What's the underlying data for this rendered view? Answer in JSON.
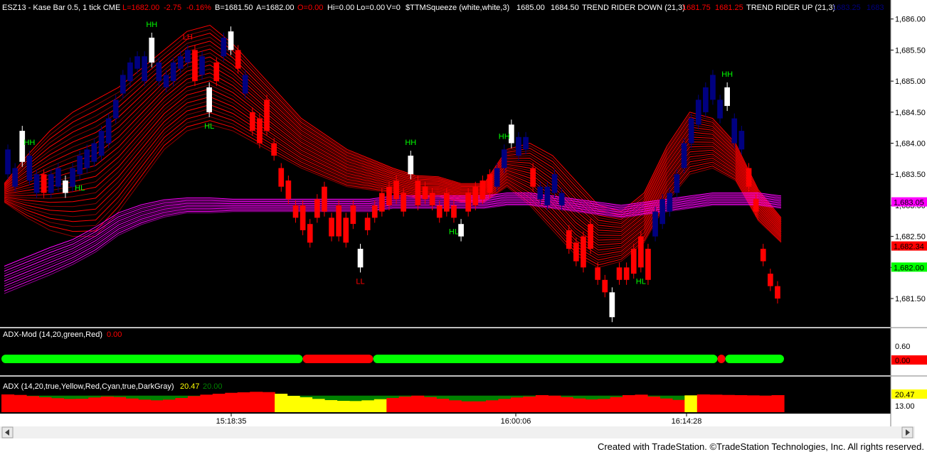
{
  "header": {
    "symbol": "ESZ13 - Kase Bar 0.5, 1 tick  CME",
    "last": "L=1682.00",
    "change": "-2.75",
    "pct": "-0.16%",
    "bid": "B=1681.50",
    "ask": "A=1682.00",
    "open": "O=0.00",
    "hi": "Hi=0.00",
    "lo": "Lo=0.00",
    "vol": "V=0",
    "squeeze": "$TTMSqueeze (white,white,3)",
    "sq1": "1685.00",
    "sq2": "1684.50",
    "trdown": "TREND RIDER DOWN (21,3)",
    "trd1": "1681.75",
    "trd2": "1681.25",
    "trup": "TREND RIDER UP (21,3)",
    "tru1": "1683.25",
    "tru2": "1683"
  },
  "colors": {
    "background": "#000000",
    "up_bar": "#000080",
    "down_bar": "#ff0000",
    "squeeze_bar": "#ffffff",
    "trend_down": "#ff0000",
    "trend_up": "#ff00ff",
    "adx_green": "#00ff00",
    "adx_red": "#ff0000",
    "adx_yellow": "#ffff00",
    "adx_fill_green": "#008000"
  },
  "chart_data": [
    {
      "type": "candlestick",
      "title": "ESZ13 - Kase Bar 0.5, 1 tick CME",
      "ylim": [
        1681.1,
        1686.1
      ],
      "y_ticks": [
        "1,686.00",
        "1,685.50",
        "1,685.00",
        "1,684.50",
        "1,684.00",
        "1,683.50",
        "1,683.00",
        "1,682.50",
        "1,682.00",
        "1,681.50"
      ],
      "x_ticks": [
        "15:18:35",
        "16:00:06",
        "16:14:28"
      ],
      "price_flags": [
        {
          "label": "1,683.05",
          "color": "#ff00ff"
        },
        {
          "label": "1,682.34",
          "color": "#ff0000"
        },
        {
          "label": "1,682.00",
          "color": "#00ff00"
        }
      ],
      "bars": [
        {
          "dir": "up",
          "o": 1683.5,
          "c": 1683.9
        },
        {
          "dir": "up",
          "o": 1683.3,
          "c": 1683.6
        },
        {
          "dir": "sq",
          "o": 1683.7,
          "c": 1684.2
        },
        {
          "dir": "up",
          "o": 1683.4,
          "c": 1683.8
        },
        {
          "dir": "up",
          "o": 1683.2,
          "c": 1683.5
        },
        {
          "dir": "down",
          "o": 1683.5,
          "c": 1683.2
        },
        {
          "dir": "up",
          "o": 1683.2,
          "c": 1683.5
        },
        {
          "dir": "up",
          "o": 1683.3,
          "c": 1683.6
        },
        {
          "dir": "sq",
          "o": 1683.2,
          "c": 1683.4
        },
        {
          "dir": "up",
          "o": 1683.3,
          "c": 1683.6
        },
        {
          "dir": "up",
          "o": 1683.5,
          "c": 1683.8
        },
        {
          "dir": "up",
          "o": 1683.6,
          "c": 1683.9
        },
        {
          "dir": "up",
          "o": 1683.7,
          "c": 1684.0
        },
        {
          "dir": "up",
          "o": 1683.8,
          "c": 1684.2
        },
        {
          "dir": "up",
          "o": 1684.0,
          "c": 1684.4
        },
        {
          "dir": "up",
          "o": 1684.4,
          "c": 1684.7
        },
        {
          "dir": "up",
          "o": 1684.8,
          "c": 1685.1
        },
        {
          "dir": "up",
          "o": 1685.0,
          "c": 1685.3
        },
        {
          "dir": "up",
          "o": 1685.2,
          "c": 1685.4
        },
        {
          "dir": "up",
          "o": 1685.0,
          "c": 1685.4
        },
        {
          "dir": "sq",
          "o": 1685.3,
          "c": 1685.7
        },
        {
          "dir": "up",
          "o": 1685.0,
          "c": 1685.3
        },
        {
          "dir": "up",
          "o": 1684.9,
          "c": 1685.1
        },
        {
          "dir": "up",
          "o": 1685.0,
          "c": 1685.3
        },
        {
          "dir": "up",
          "o": 1685.2,
          "c": 1685.4
        },
        {
          "dir": "up",
          "o": 1685.3,
          "c": 1685.5
        },
        {
          "dir": "down",
          "o": 1685.5,
          "c": 1685.0
        },
        {
          "dir": "up",
          "o": 1685.1,
          "c": 1685.4
        },
        {
          "dir": "sq",
          "o": 1684.5,
          "c": 1684.9
        },
        {
          "dir": "down",
          "o": 1685.3,
          "c": 1685.0
        },
        {
          "dir": "up",
          "o": 1685.4,
          "c": 1685.7
        },
        {
          "dir": "sq",
          "o": 1685.5,
          "c": 1685.8
        },
        {
          "dir": "down",
          "o": 1685.5,
          "c": 1685.2
        },
        {
          "dir": "up",
          "o": 1684.8,
          "c": 1685.1
        },
        {
          "dir": "down",
          "o": 1684.5,
          "c": 1684.2
        },
        {
          "dir": "down",
          "o": 1684.4,
          "c": 1684.0
        },
        {
          "dir": "down",
          "o": 1684.7,
          "c": 1684.2
        },
        {
          "dir": "down",
          "o": 1684.0,
          "c": 1683.8
        },
        {
          "dir": "down",
          "o": 1683.6,
          "c": 1683.3
        },
        {
          "dir": "down",
          "o": 1683.4,
          "c": 1683.1
        },
        {
          "dir": "down",
          "o": 1683.0,
          "c": 1682.8
        },
        {
          "dir": "down",
          "o": 1683.0,
          "c": 1682.6
        },
        {
          "dir": "down",
          "o": 1682.7,
          "c": 1682.4
        },
        {
          "dir": "down",
          "o": 1683.1,
          "c": 1682.8
        },
        {
          "dir": "down",
          "o": 1683.3,
          "c": 1682.9
        },
        {
          "dir": "down",
          "o": 1682.8,
          "c": 1682.5
        },
        {
          "dir": "down",
          "o": 1683.0,
          "c": 1682.5
        },
        {
          "dir": "down",
          "o": 1682.8,
          "c": 1682.4
        },
        {
          "dir": "down",
          "o": 1683.0,
          "c": 1682.7
        },
        {
          "dir": "sq",
          "o": 1682.0,
          "c": 1682.3
        },
        {
          "dir": "down",
          "o": 1682.8,
          "c": 1682.6
        },
        {
          "dir": "down",
          "o": 1683.0,
          "c": 1682.8
        },
        {
          "dir": "down",
          "o": 1683.2,
          "c": 1682.9
        },
        {
          "dir": "down",
          "o": 1683.3,
          "c": 1683.0
        },
        {
          "dir": "down",
          "o": 1683.4,
          "c": 1683.1
        },
        {
          "dir": "down",
          "o": 1683.2,
          "c": 1682.9
        },
        {
          "dir": "sq",
          "o": 1683.5,
          "c": 1683.8
        },
        {
          "dir": "down",
          "o": 1683.4,
          "c": 1683.0
        },
        {
          "dir": "down",
          "o": 1683.3,
          "c": 1683.1
        },
        {
          "dir": "down",
          "o": 1683.2,
          "c": 1683.0
        },
        {
          "dir": "down",
          "o": 1683.0,
          "c": 1682.8
        },
        {
          "dir": "down",
          "o": 1683.2,
          "c": 1682.9
        },
        {
          "dir": "down",
          "o": 1683.0,
          "c": 1682.8
        },
        {
          "dir": "sq",
          "o": 1682.5,
          "c": 1682.7
        },
        {
          "dir": "down",
          "o": 1683.2,
          "c": 1682.9
        },
        {
          "dir": "down",
          "o": 1683.3,
          "c": 1683.0
        },
        {
          "dir": "down",
          "o": 1683.4,
          "c": 1683.1
        },
        {
          "dir": "down",
          "o": 1683.5,
          "c": 1683.2
        },
        {
          "dir": "up",
          "o": 1683.3,
          "c": 1683.6
        },
        {
          "dir": "up",
          "o": 1683.6,
          "c": 1683.9
        },
        {
          "dir": "sq",
          "o": 1684.0,
          "c": 1684.3
        },
        {
          "dir": "up",
          "o": 1683.8,
          "c": 1684.1
        },
        {
          "dir": "up",
          "o": 1683.9,
          "c": 1684.1
        },
        {
          "dir": "down",
          "o": 1683.6,
          "c": 1683.3
        },
        {
          "dir": "up",
          "o": 1683.1,
          "c": 1683.3
        },
        {
          "dir": "up",
          "o": 1683.0,
          "c": 1683.3
        },
        {
          "dir": "up",
          "o": 1683.2,
          "c": 1683.5
        },
        {
          "dir": "up",
          "o": 1683.0,
          "c": 1683.2
        },
        {
          "dir": "down",
          "o": 1682.6,
          "c": 1682.3
        },
        {
          "dir": "down",
          "o": 1682.4,
          "c": 1682.1
        },
        {
          "dir": "down",
          "o": 1682.5,
          "c": 1682.0
        },
        {
          "dir": "down",
          "o": 1682.7,
          "c": 1682.3
        },
        {
          "dir": "down",
          "o": 1682.0,
          "c": 1681.8
        },
        {
          "dir": "down",
          "o": 1681.8,
          "c": 1681.6
        },
        {
          "dir": "sq",
          "o": 1681.2,
          "c": 1681.6
        },
        {
          "dir": "down",
          "o": 1682.0,
          "c": 1681.8
        },
        {
          "dir": "down",
          "o": 1682.0,
          "c": 1681.8
        },
        {
          "dir": "down",
          "o": 1682.3,
          "c": 1681.9
        },
        {
          "dir": "down",
          "o": 1682.5,
          "c": 1682.0
        },
        {
          "dir": "down",
          "o": 1682.3,
          "c": 1681.8
        },
        {
          "dir": "up",
          "o": 1682.5,
          "c": 1682.9
        },
        {
          "dir": "up",
          "o": 1682.7,
          "c": 1683.1
        },
        {
          "dir": "up",
          "o": 1682.9,
          "c": 1683.2
        },
        {
          "dir": "up",
          "o": 1683.2,
          "c": 1683.5
        },
        {
          "dir": "up",
          "o": 1683.6,
          "c": 1684.0
        },
        {
          "dir": "up",
          "o": 1684.0,
          "c": 1684.4
        },
        {
          "dir": "up",
          "o": 1684.3,
          "c": 1684.7
        },
        {
          "dir": "up",
          "o": 1684.5,
          "c": 1684.9
        },
        {
          "dir": "up",
          "o": 1684.7,
          "c": 1685.1
        },
        {
          "dir": "up",
          "o": 1684.4,
          "c": 1684.7
        },
        {
          "dir": "sq",
          "o": 1684.6,
          "c": 1684.9
        },
        {
          "dir": "up",
          "o": 1684.0,
          "c": 1684.4
        },
        {
          "dir": "up",
          "o": 1683.9,
          "c": 1684.2
        },
        {
          "dir": "down",
          "o": 1683.6,
          "c": 1683.3
        },
        {
          "dir": "down",
          "o": 1683.1,
          "c": 1682.9
        },
        {
          "dir": "down",
          "o": 1682.3,
          "c": 1682.1
        },
        {
          "dir": "down",
          "o": 1681.9,
          "c": 1681.7
        },
        {
          "dir": "down",
          "o": 1681.7,
          "c": 1681.5
        }
      ],
      "annotations": [
        {
          "text": "HH",
          "bar": 3,
          "color": "#00ff00",
          "pos": "above"
        },
        {
          "text": "HL",
          "bar": 10,
          "color": "#00ff00",
          "pos": "below"
        },
        {
          "text": "HH",
          "bar": 20,
          "color": "#00ff00",
          "pos": "above"
        },
        {
          "text": "LH",
          "bar": 25,
          "color": "#ff0000",
          "pos": "above"
        },
        {
          "text": "HL",
          "bar": 28,
          "color": "#00ff00",
          "pos": "below"
        },
        {
          "text": "LL",
          "bar": 49,
          "color": "#ff0000",
          "pos": "below"
        },
        {
          "text": "HH",
          "bar": 56,
          "color": "#00ff00",
          "pos": "above"
        },
        {
          "text": "HL",
          "bar": 62,
          "color": "#00ff00",
          "pos": "below"
        },
        {
          "text": "HH",
          "bar": 69,
          "color": "#00ff00",
          "pos": "above"
        },
        {
          "text": "HL",
          "bar": 88,
          "color": "#00ff00",
          "pos": "below"
        },
        {
          "text": "HH",
          "bar": 100,
          "color": "#00ff00",
          "pos": "above"
        }
      ],
      "trend_rider_down": {
        "name": "TREND RIDER DOWN (21,3)",
        "center": [
          1683.2,
          1683.3,
          1683.4,
          1683.5,
          1683.6,
          1683.9,
          1684.3,
          1684.7,
          1685.0,
          1685.1,
          1684.9,
          1684.6,
          1684.3,
          1684.0,
          1683.8,
          1683.6,
          1683.5,
          1683.4,
          1683.3,
          1683.3,
          1683.2,
          1683.2,
          1683.6,
          1683.5,
          1683.2,
          1682.8,
          1682.5,
          1682.5,
          1682.8,
          1683.5,
          1684.0,
          1684.0,
          1683.7,
          1683.0,
          1682.6
        ],
        "spread": [
          0.15,
          0.5,
          0.8,
          1.0,
          1.1,
          1.0,
          0.9,
          0.8,
          0.8,
          0.8,
          0.7,
          0.6,
          0.5,
          0.4,
          0.35,
          0.3,
          0.25,
          0.2,
          0.18,
          0.16,
          0.15,
          0.15,
          0.3,
          0.5,
          0.6,
          0.6,
          0.5,
          0.4,
          0.4,
          0.45,
          0.5,
          0.4,
          0.3,
          0.25,
          0.2
        ]
      },
      "trend_rider_up": {
        "name": "TREND RIDER UP (21,3)",
        "center": [
          1681.8,
          1681.95,
          1682.1,
          1682.25,
          1682.45,
          1682.7,
          1682.85,
          1682.95,
          1683.0,
          1683.0,
          1683.0,
          1683.0,
          1683.0,
          1683.0,
          1683.0,
          1683.0,
          1683.0,
          1683.05,
          1683.05,
          1683.05,
          1683.05,
          1683.05,
          1683.1,
          1683.1,
          1683.05,
          1683.0,
          1682.95,
          1682.9,
          1682.95,
          1683.0,
          1683.05,
          1683.1,
          1683.1,
          1683.1,
          1683.05
        ],
        "spread": [
          0.22,
          0.22,
          0.22,
          0.2,
          0.2,
          0.18,
          0.16,
          0.14,
          0.12,
          0.12,
          0.1,
          0.1,
          0.1,
          0.1,
          0.1,
          0.1,
          0.1,
          0.1,
          0.1,
          0.1,
          0.1,
          0.1,
          0.1,
          0.1,
          0.1,
          0.1,
          0.1,
          0.1,
          0.1,
          0.1,
          0.1,
          0.1,
          0.1,
          0.1,
          0.1
        ]
      }
    },
    {
      "type": "indicator",
      "title": "ADX-Mod (14,20,green,Red)",
      "value_label": "0.00",
      "y_ticks": [
        "0.60"
      ],
      "flag": "0.00",
      "segments": [
        {
          "from": 0,
          "to": 0.385,
          "color": "#00ff00"
        },
        {
          "from": 0.385,
          "to": 0.475,
          "color": "#ff0000"
        },
        {
          "from": 0.475,
          "to": 0.915,
          "color": "#00ff00"
        },
        {
          "from": 0.915,
          "to": 0.925,
          "color": "#ff0000"
        },
        {
          "from": 0.925,
          "to": 1.0,
          "color": "#00ff00"
        }
      ]
    },
    {
      "type": "area",
      "title": "ADX (14,20,true,Yellow,Red,Cyan,true,DarkGray)",
      "value1": "20.47",
      "value2": "20.00",
      "y_ticks": [
        "13.00"
      ],
      "flag": "20.47",
      "threshold": 20,
      "ylim": [
        13.0,
        22.0
      ],
      "adx": [
        20.5,
        20.3,
        19.8,
        19.3,
        18.9,
        18.6,
        18.7,
        19.2,
        19.6,
        19.4,
        18.8,
        18.3,
        18.0,
        18.3,
        19.0,
        19.8,
        20.4,
        20.8,
        21.2,
        21.4,
        21.6,
        21.5,
        20.8,
        19.9,
        19.3,
        18.6,
        18.1,
        17.8,
        17.7,
        18.0,
        18.5,
        19.0,
        19.6,
        20.0,
        19.4,
        18.7,
        18.0,
        17.6,
        17.6,
        18.0,
        18.6,
        19.2,
        19.6,
        20.2,
        20.0,
        19.4,
        18.8,
        18.4,
        18.6,
        19.4,
        20.2,
        20.4,
        19.6,
        18.8,
        18.2,
        20.1,
        20.5,
        20.4,
        20.3,
        20.2,
        20.1,
        20.0,
        20.2,
        20.5
      ],
      "adx_colors": [
        "r",
        "r",
        "r",
        "r",
        "r",
        "r",
        "r",
        "r",
        "r",
        "r",
        "r",
        "r",
        "r",
        "r",
        "r",
        "r",
        "r",
        "r",
        "r",
        "r",
        "r",
        "r",
        "y",
        "y",
        "y",
        "y",
        "y",
        "y",
        "y",
        "y",
        "y",
        "r",
        "r",
        "r",
        "r",
        "r",
        "r",
        "r",
        "r",
        "r",
        "r",
        "r",
        "r",
        "r",
        "r",
        "r",
        "r",
        "r",
        "r",
        "r",
        "r",
        "r",
        "r",
        "r",
        "r",
        "y",
        "r",
        "r",
        "r",
        "r",
        "r",
        "r",
        "r",
        "y"
      ]
    }
  ],
  "footer": "Created with TradeStation. ©TradeStation Technologies, Inc. All rights reserved."
}
